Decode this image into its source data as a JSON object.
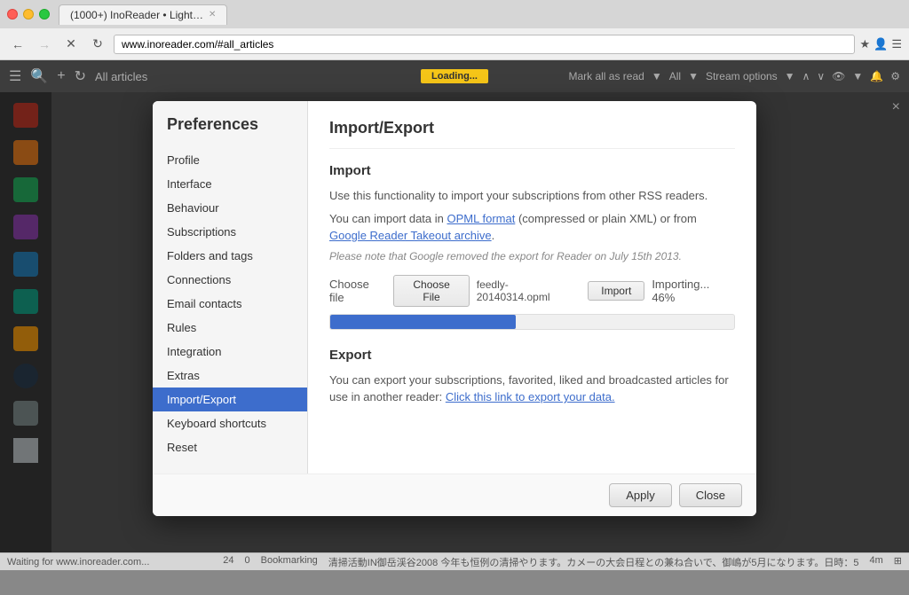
{
  "browser": {
    "tab_label": "(1000+) InoReader • Light…",
    "url": "www.inoreader.com/#all_articles",
    "back_btn": "←",
    "forward_btn": "→",
    "refresh_btn": "↻",
    "close_btn": "✕"
  },
  "toolbar": {
    "all_articles": "All articles",
    "loading_text": "Loading...",
    "mark_all_read": "Mark all as read",
    "all_label": "All",
    "stream_options": "Stream options"
  },
  "preferences": {
    "title": "Preferences",
    "page_title": "Import/Export",
    "close_btn": "×",
    "nav_items": [
      {
        "id": "profile",
        "label": "Profile"
      },
      {
        "id": "interface",
        "label": "Interface"
      },
      {
        "id": "behaviour",
        "label": "Behaviour"
      },
      {
        "id": "subscriptions",
        "label": "Subscriptions"
      },
      {
        "id": "folders-tags",
        "label": "Folders and tags"
      },
      {
        "id": "connections",
        "label": "Connections"
      },
      {
        "id": "email-contacts",
        "label": "Email contacts"
      },
      {
        "id": "rules",
        "label": "Rules"
      },
      {
        "id": "integration",
        "label": "Integration"
      },
      {
        "id": "extras",
        "label": "Extras"
      },
      {
        "id": "import-export",
        "label": "Import/Export"
      },
      {
        "id": "keyboard-shortcuts",
        "label": "Keyboard shortcuts"
      },
      {
        "id": "reset",
        "label": "Reset"
      }
    ],
    "import": {
      "section_title": "Import",
      "line1": "Use this functionality to import your subscriptions from other RSS readers.",
      "line2_prefix": "You can import data in ",
      "opml_link": "OPML format",
      "line2_middle": " (compressed or plain XML) or from ",
      "google_link": "Google Reader Takeout archive",
      "line2_suffix": ".",
      "note": "Please note that Google removed the export for Reader on July 15th 2013.",
      "choose_file_label": "Choose file",
      "choose_file_btn": "Choose File",
      "filename": "feedly-20140314.opml",
      "import_btn": "Import",
      "importing_text": "Importing... 46%",
      "progress_percent": 46
    },
    "export": {
      "section_title": "Export",
      "line1_prefix": "You can export your subscriptions, favorited, liked and broadcasted articles for use in another reader: ",
      "export_link": "Click this link to export your data."
    },
    "footer": {
      "apply_label": "Apply",
      "close_label": "Close"
    }
  },
  "status_bar": {
    "waiting": "Waiting for www.inoreader.com...",
    "count1": "24",
    "count2": "0",
    "activity": "Bookmarking",
    "japanese_text": "清掃活動IN御岳渓谷2008 今年も恒例の清掃やります。カメーの大会日程との兼ね合いで、御嶋が5月になります。日時：5",
    "time": "4m",
    "icon": "⊞"
  }
}
